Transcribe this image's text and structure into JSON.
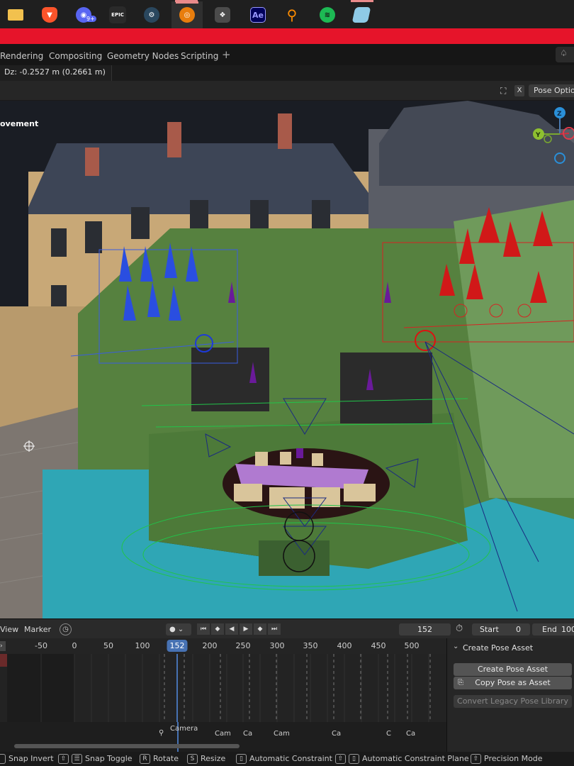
{
  "taskbar": {
    "icons": [
      {
        "name": "file-explorer-icon",
        "color": "#f2c14e"
      },
      {
        "name": "brave-icon",
        "color": "#fb542b"
      },
      {
        "name": "discord-icon",
        "color": "#5865f2",
        "badge": "9+"
      },
      {
        "name": "epic-games-icon",
        "color": "#2a2a2a",
        "text": "EPIC GAMES"
      },
      {
        "name": "steam-icon",
        "color": "#1b2838"
      },
      {
        "name": "blender-icon",
        "color": "#e87d0d"
      },
      {
        "name": "davinci-resolve-icon",
        "color": "#4b4b4b"
      },
      {
        "name": "after-effects-icon",
        "color": "#9999ff",
        "text": "Ae"
      },
      {
        "name": "everything-search-icon",
        "color": "#ff8c00"
      },
      {
        "name": "spotify-icon",
        "color": "#1db954"
      },
      {
        "name": "app-icon",
        "color": "#8ecae6"
      }
    ]
  },
  "workspace_tabs": [
    "Rendering",
    "Compositing",
    "Geometry Nodes",
    "Scripting"
  ],
  "workspace_add": "+",
  "status": {
    "dz": "Dz: -0.2527 m (0.2661 m)"
  },
  "viewport_header": {
    "x_label": "X",
    "pose_options": "Pose Options"
  },
  "viewport": {
    "mode_label": "ovement"
  },
  "gizmo": {
    "z": "Z",
    "y": "Y"
  },
  "timeline": {
    "menu": [
      "View",
      "Marker"
    ],
    "current_frame": "152",
    "start_label": "Start",
    "start_value": "0",
    "end_label": "End",
    "end_value": "100",
    "ruler": [
      "-50",
      "0",
      "50",
      "100",
      "152",
      "200",
      "250",
      "300",
      "350",
      "400",
      "450",
      "500"
    ],
    "markers": [
      "Camera",
      "Cam",
      "Ca",
      "Cam",
      "Ca",
      "C",
      "Ca"
    ]
  },
  "side_panel": {
    "header": "Create Pose Asset",
    "create_button": "Create Pose Asset",
    "copy_button": "Copy Pose as Asset",
    "convert_button": "Convert Legacy Pose Library"
  },
  "statusbar": {
    "items": [
      {
        "key": "",
        "label": "Snap Invert"
      },
      {
        "key": "⇧",
        "label": "Snap Toggle"
      },
      {
        "key": "R",
        "label": "Rotate"
      },
      {
        "key": "S",
        "label": "Resize"
      },
      {
        "key": "",
        "label": "Automatic Constraint"
      },
      {
        "key": "⇧",
        "label": "Automatic Constraint Plane"
      },
      {
        "key": "⇧",
        "label": "Precision Mode"
      }
    ]
  }
}
